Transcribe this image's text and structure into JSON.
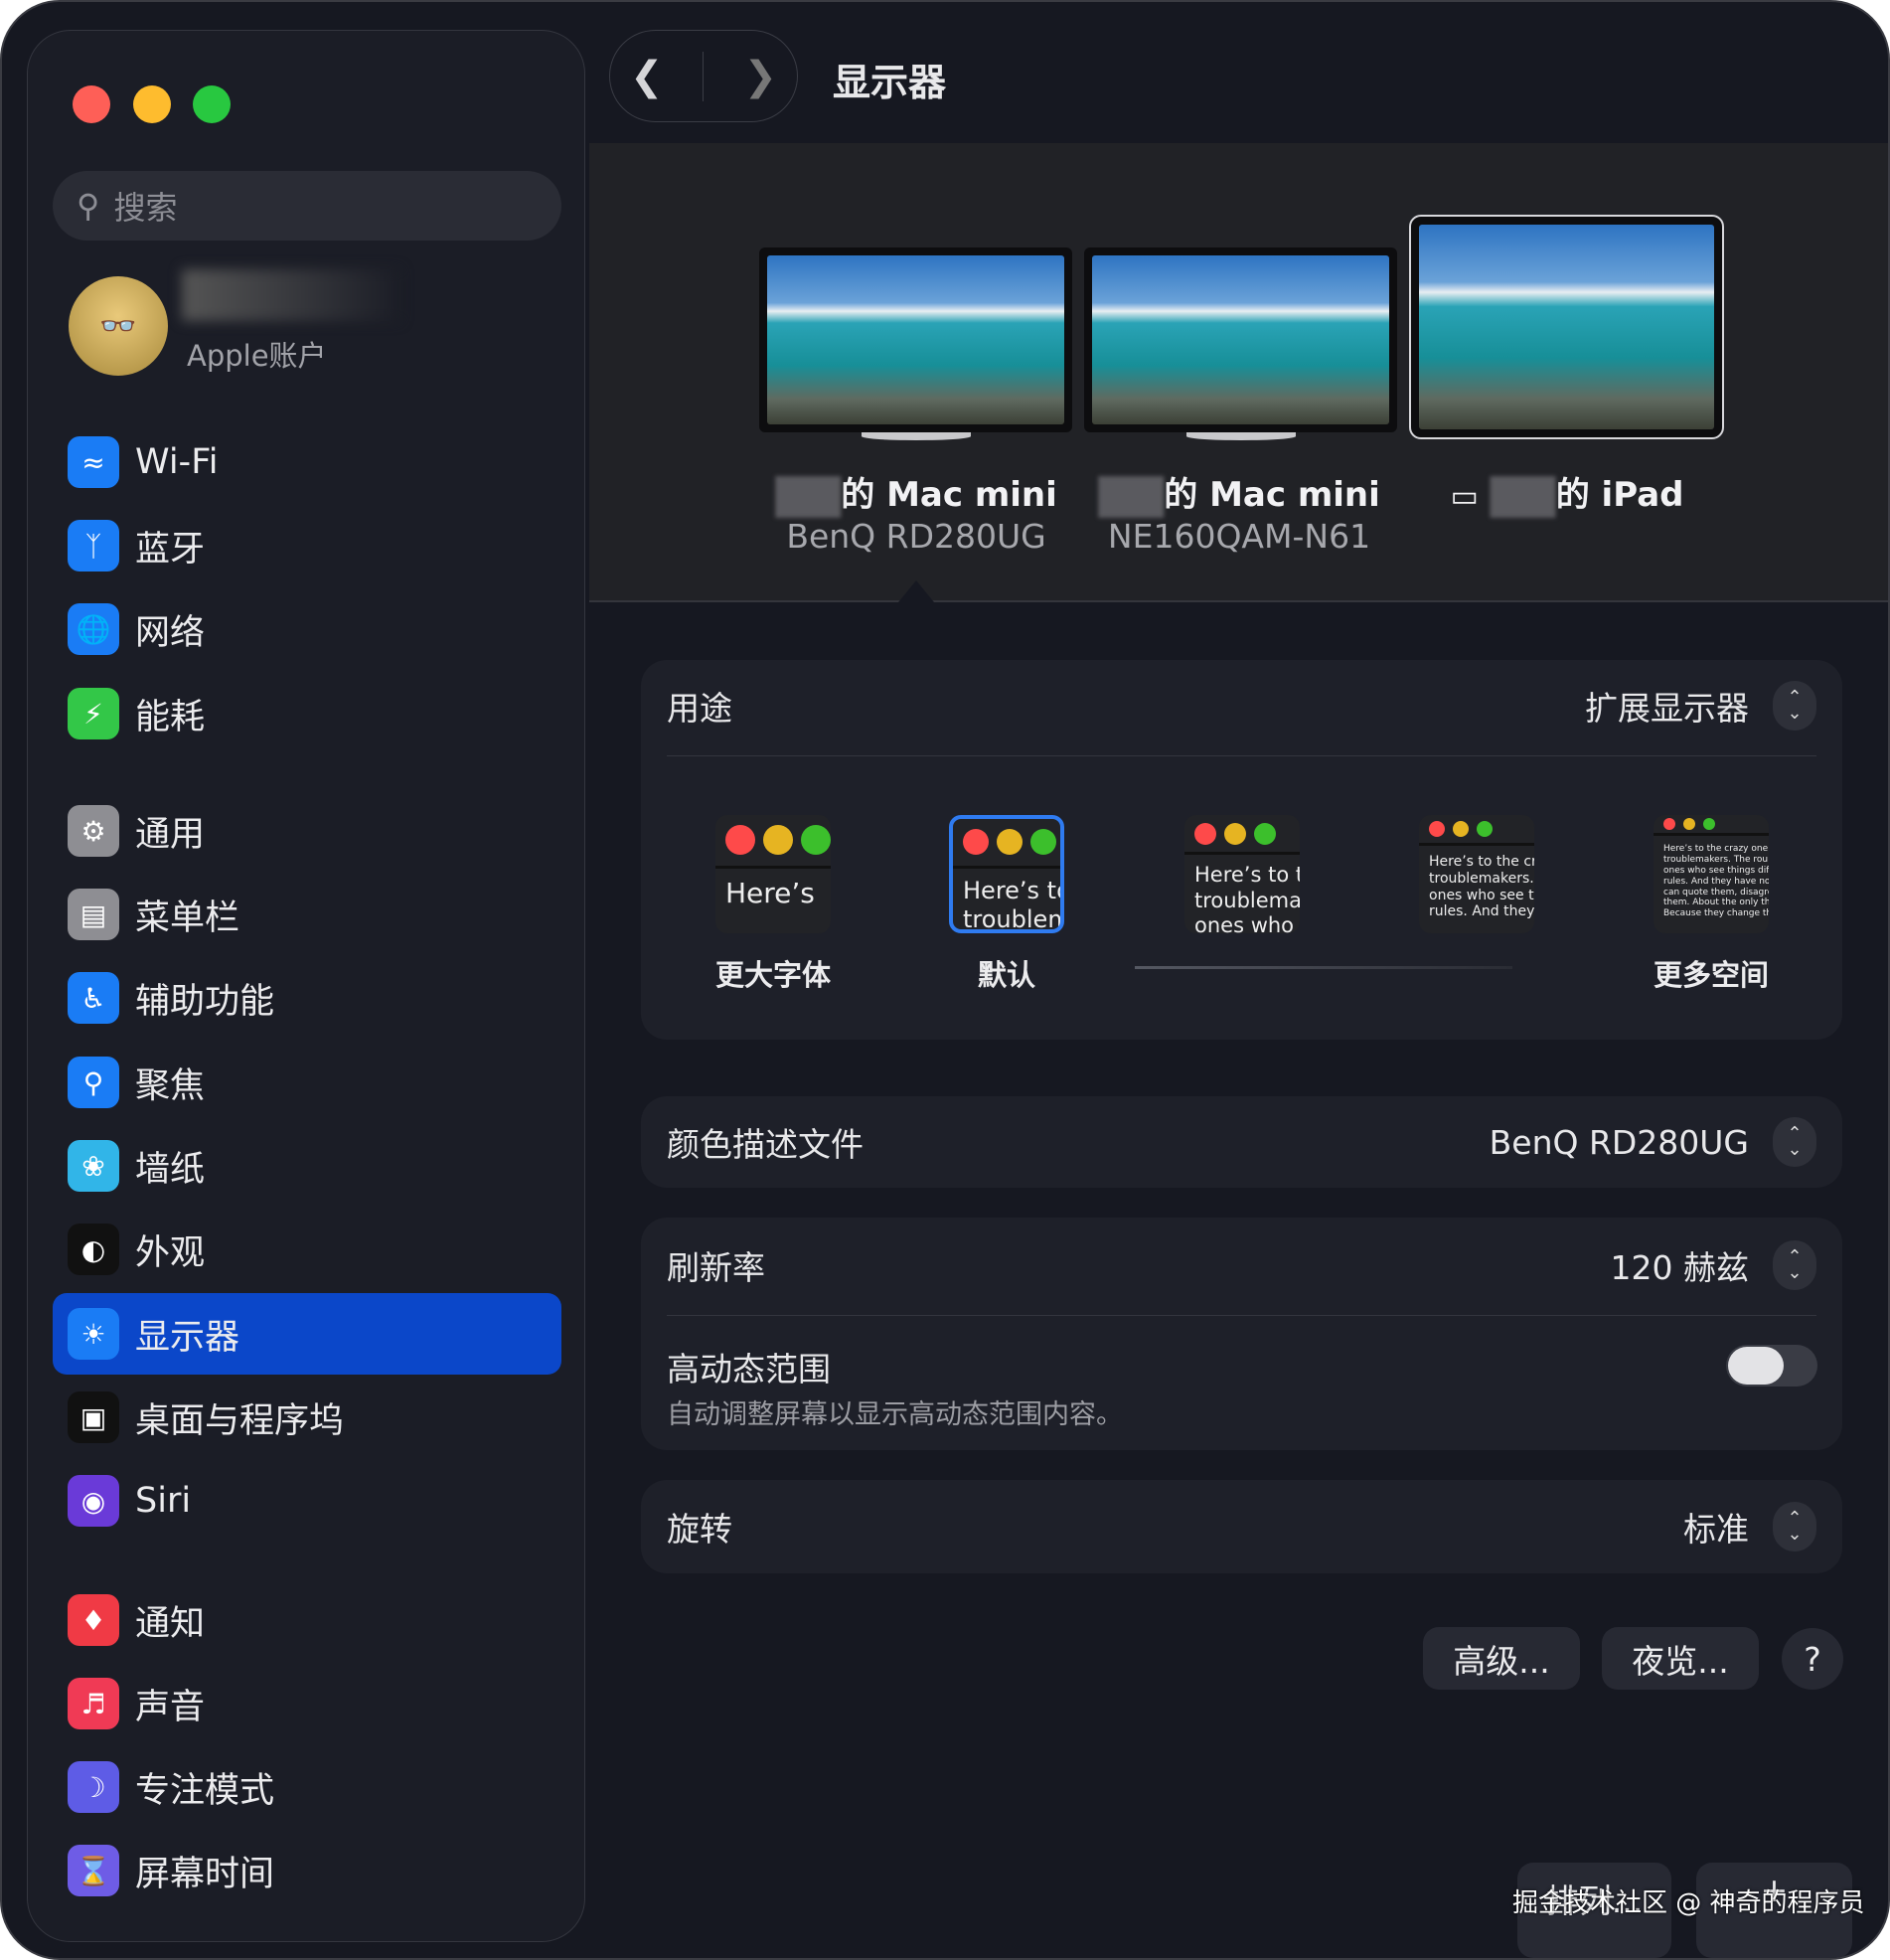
{
  "window": {
    "title": "显示器"
  },
  "sidebar": {
    "search_placeholder": "搜索",
    "account": {
      "label": "Apple账户"
    },
    "items": [
      {
        "label": "Wi-Fi",
        "icon": "wifi-icon",
        "color": "#1a7cf5"
      },
      {
        "label": "蓝牙",
        "icon": "bluetooth-icon",
        "color": "#1a7cf5"
      },
      {
        "label": "网络",
        "icon": "globe-icon",
        "color": "#1a7cf5"
      },
      {
        "label": "能耗",
        "icon": "battery-bolt-icon",
        "color": "#33c748"
      },
      {
        "label": "通用",
        "icon": "gear-icon",
        "color": "#8e8e93"
      },
      {
        "label": "菜单栏",
        "icon": "menubar-icon",
        "color": "#8e8e93"
      },
      {
        "label": "辅助功能",
        "icon": "accessibility-icon",
        "color": "#1a7cf5"
      },
      {
        "label": "聚焦",
        "icon": "spotlight-icon",
        "color": "#1a7cf5"
      },
      {
        "label": "墙纸",
        "icon": "wallpaper-flower-icon",
        "color": "#31b5e8"
      },
      {
        "label": "外观",
        "icon": "appearance-icon",
        "color": "#111111"
      },
      {
        "label": "显示器",
        "icon": "display-brightness-icon",
        "color": "#1a7cf5"
      },
      {
        "label": "桌面与程序坞",
        "icon": "dock-icon",
        "color": "#111111"
      },
      {
        "label": "Siri",
        "icon": "siri-icon",
        "color": "#6a3ad8"
      },
      {
        "label": "通知",
        "icon": "bell-icon",
        "color": "#f03a45"
      },
      {
        "label": "声音",
        "icon": "speaker-icon",
        "color": "#f03a55"
      },
      {
        "label": "专注模式",
        "icon": "moon-icon",
        "color": "#5e5ce6"
      },
      {
        "label": "屏幕时间",
        "icon": "hourglass-icon",
        "color": "#6e5ce6"
      }
    ],
    "selected": "显示器"
  },
  "displays": [
    {
      "name": "的 Mac mini",
      "model": "BenQ RD280UG",
      "selected": true
    },
    {
      "name": "的 Mac mini",
      "model": "NE160QAM-N61"
    },
    {
      "name": "的 iPad",
      "airplay": true
    }
  ],
  "usage": {
    "label": "用途",
    "value": "扩展显示器",
    "options": [
      {
        "label": "更大字体",
        "preview": "Here’s"
      },
      {
        "label": "默认",
        "preview": "Here’s to\ntroublem",
        "selected": true
      },
      {
        "label": "",
        "preview": "Here’s to t\ntroublema\nones who"
      },
      {
        "label": "",
        "preview": "Here’s to the cr\ntroublemakers.\nones who see t\nrules. And they"
      },
      {
        "label": "更多空间",
        "preview": "Here’s to the crazy one\ntroublemakers. The rou\nones who see things dif\nrules. And they have no\ncan quote them, disagre\nthem. About the only th\nBecause they change th"
      }
    ]
  },
  "color_profile": {
    "label": "颜色描述文件",
    "value": "BenQ RD280UG"
  },
  "refresh_rate": {
    "label": "刷新率",
    "value": "120 赫兹"
  },
  "hdr": {
    "label": "高动态范围",
    "description": "自动调整屏幕以显示高动态范围内容。",
    "enabled": false
  },
  "rotation": {
    "label": "旋转",
    "value": "标准"
  },
  "buttons": {
    "advanced": "高级...",
    "night_shift": "夜览...",
    "help": "?",
    "arrange": "排列...",
    "add": "+"
  },
  "watermark": "掘金技术社区 @ 神奇的程序员"
}
